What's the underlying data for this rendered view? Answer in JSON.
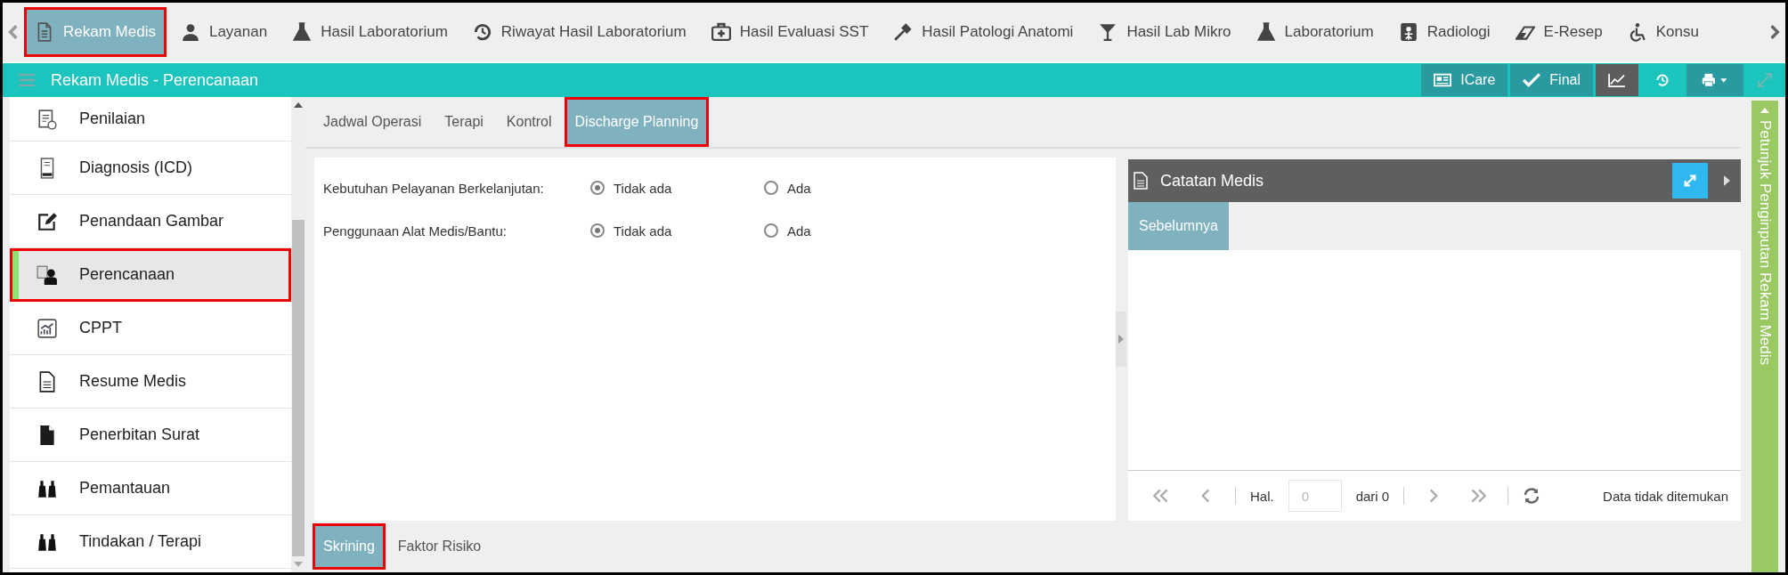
{
  "top_nav": {
    "items": [
      {
        "label": "Rekam Medis",
        "selected": true
      },
      {
        "label": "Layanan",
        "selected": false
      },
      {
        "label": "Hasil Laboratorium",
        "selected": false
      },
      {
        "label": "Riwayat Hasil Laboratorium",
        "selected": false
      },
      {
        "label": "Hasil Evaluasi SST",
        "selected": false
      },
      {
        "label": "Hasil Patologi Anatomi",
        "selected": false
      },
      {
        "label": "Hasil Lab Mikro",
        "selected": false
      },
      {
        "label": "Laboratorium",
        "selected": false
      },
      {
        "label": "Radiologi",
        "selected": false
      },
      {
        "label": "E-Resep",
        "selected": false
      },
      {
        "label": "Konsu",
        "selected": false
      }
    ]
  },
  "header": {
    "title": "Rekam Medis - Perencanaan",
    "buttons": [
      "ICare",
      "Final"
    ]
  },
  "sidebar": {
    "items": [
      {
        "label": "Penilaian",
        "selected": false
      },
      {
        "label": "Diagnosis (ICD)",
        "selected": false
      },
      {
        "label": "Penandaan Gambar",
        "selected": false
      },
      {
        "label": "Perencanaan",
        "selected": true
      },
      {
        "label": "CPPT",
        "selected": false
      },
      {
        "label": "Resume Medis",
        "selected": false
      },
      {
        "label": "Penerbitan Surat",
        "selected": false
      },
      {
        "label": "Pemantauan",
        "selected": false
      },
      {
        "label": "Tindakan / Terapi",
        "selected": false
      }
    ]
  },
  "sub_tabs": [
    {
      "label": "Jadwal Operasi",
      "selected": false
    },
    {
      "label": "Terapi",
      "selected": false
    },
    {
      "label": "Kontrol",
      "selected": false
    },
    {
      "label": "Discharge Planning",
      "selected": true
    }
  ],
  "form": {
    "rows": [
      {
        "label": "Kebutuhan Pelayanan Berkelanjutan:",
        "options": [
          {
            "label": "Tidak ada",
            "selected": true
          },
          {
            "label": "Ada",
            "selected": false
          }
        ]
      },
      {
        "label": "Penggunaan Alat Medis/Bantu:",
        "options": [
          {
            "label": "Tidak ada",
            "selected": true
          },
          {
            "label": "Ada",
            "selected": false
          }
        ]
      }
    ]
  },
  "notes_panel": {
    "title": "Catatan Medis",
    "tabs": [
      {
        "label": "Sebelumnya",
        "selected": true
      }
    ],
    "pager": {
      "page_label": "Hal.",
      "page_value": "0",
      "of_label": "dari 0",
      "status": "Data tidak ditemukan"
    }
  },
  "bottom_tabs": [
    {
      "label": "Skrining",
      "selected": true
    },
    {
      "label": "Faktor Risiko",
      "selected": false
    }
  ],
  "side_strip": {
    "label": "Petunjuk Penginputan Rekam Medis"
  }
}
